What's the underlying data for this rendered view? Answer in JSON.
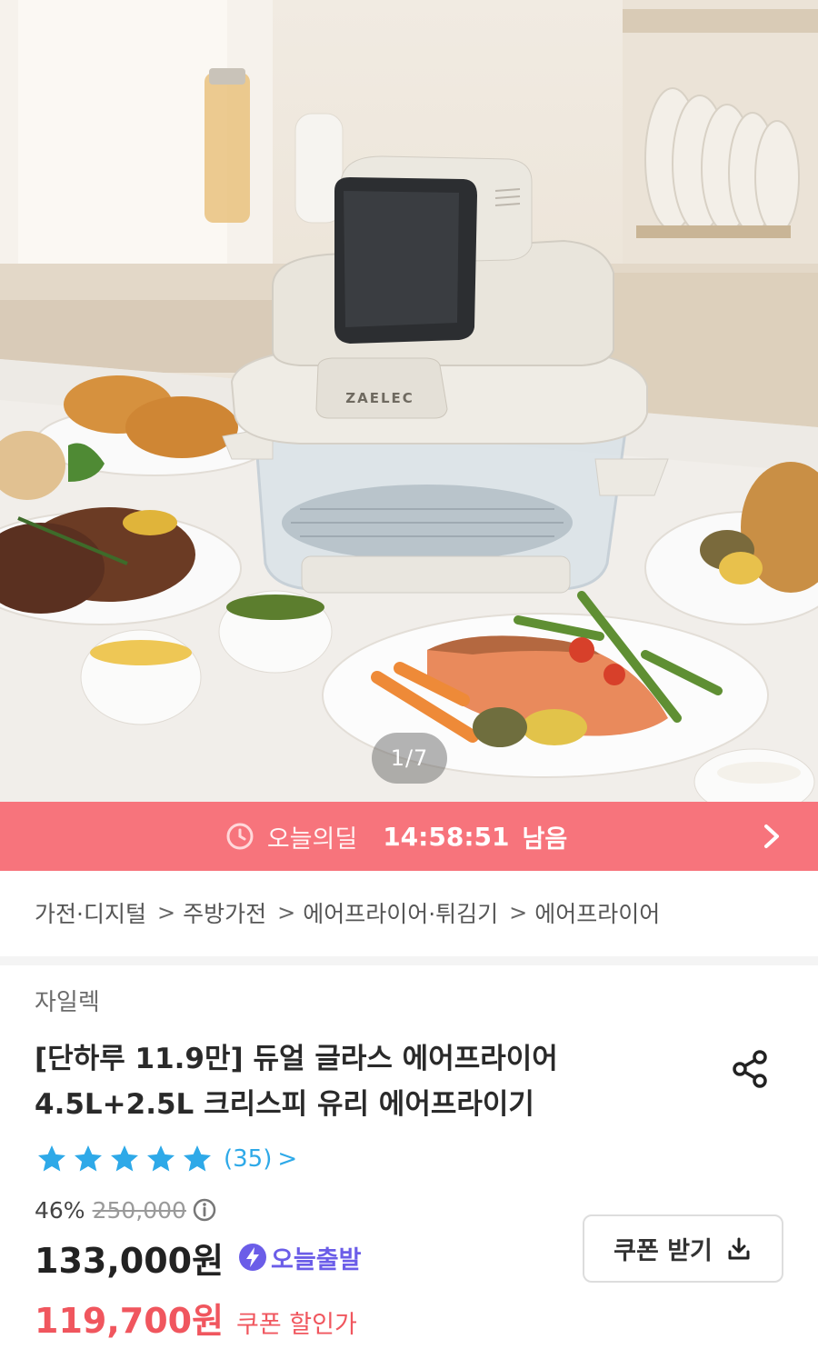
{
  "gallery": {
    "counter": "1/7",
    "product_brand_mark": "ZAELEC"
  },
  "deal": {
    "label": "오늘의딜",
    "timer": "14:58:51",
    "remaining": "남음",
    "background_color": "#f7747c"
  },
  "breadcrumb": {
    "items": [
      "가전·디지털",
      "주방가전",
      "에어프라이어·튀김기",
      "에어프라이어"
    ],
    "separator": ">"
  },
  "product": {
    "brand": "자일렉",
    "title_line1": "[단하루 11.9만] 듀얼 글라스 에어프라이어",
    "title_line2": "4.5L+2.5L 크리스피 유리 에어프라이기",
    "rating": 5,
    "review_count": "(35)",
    "review_chevron": ">",
    "discount_rate": "46%",
    "original_price": "250,000",
    "price": "133,000원",
    "shipping_badge": "오늘출발",
    "coupon_price": "119,700원",
    "coupon_price_label": "쿠폰 할인가",
    "coupon_button_label": "쿠폰 받기"
  },
  "colors": {
    "accent_red": "#f0565e",
    "star_blue": "#2ea9e8",
    "shipping_purple": "#6b5de8"
  }
}
